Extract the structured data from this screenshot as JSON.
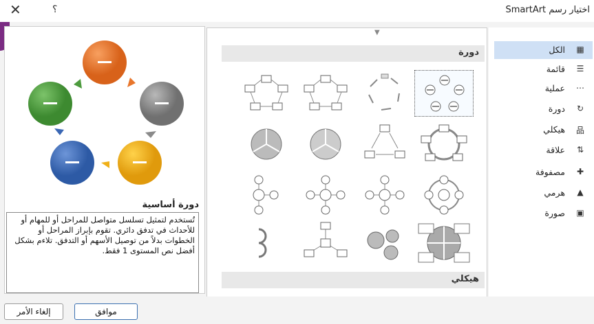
{
  "window": {
    "title": "اختيار رسم SmartArt",
    "close_glyph": "✕",
    "help_glyph": "؟"
  },
  "sidebar": {
    "items": [
      {
        "label": "الكل",
        "icon": "all-icon",
        "glyph": "▦"
      },
      {
        "label": "قائمة",
        "icon": "list-icon",
        "glyph": "☰"
      },
      {
        "label": "عملية",
        "icon": "process-icon",
        "glyph": "⋯"
      },
      {
        "label": "دورة",
        "icon": "cycle-icon",
        "glyph": "↻"
      },
      {
        "label": "هيكلي",
        "icon": "hierarchy-icon",
        "glyph": "品"
      },
      {
        "label": "علاقة",
        "icon": "relationship-icon",
        "glyph": "⇅"
      },
      {
        "label": "مصفوفة",
        "icon": "matrix-icon",
        "glyph": "✚"
      },
      {
        "label": "هرمي",
        "icon": "pyramid-icon",
        "glyph": "▲"
      },
      {
        "label": "صورة",
        "icon": "picture-icon",
        "glyph": "▣"
      }
    ],
    "selected": "الكل"
  },
  "gallery": {
    "sections": [
      {
        "title": "دورة"
      },
      {
        "title": "هيكلي"
      }
    ]
  },
  "preview": {
    "title": "دورة أساسية",
    "description": "تُستخدم لتمثيل تسلسل متواصل للمراحل أو للمهام أو للأحداث في تدفق دائري. تقوم بإبراز المراحل أو الخطوات بدلاً من توصيل الأسهم أو التدفق. تلاءم بشكل أفضل نص المستوى 1 فقط.",
    "circle_colors": [
      "#e8762c",
      "#8a8a8a",
      "#f0b018",
      "#3a67b4",
      "#4d9b3e"
    ]
  },
  "buttons": {
    "ok": "موافق",
    "cancel": "إلغاء الأمر"
  }
}
